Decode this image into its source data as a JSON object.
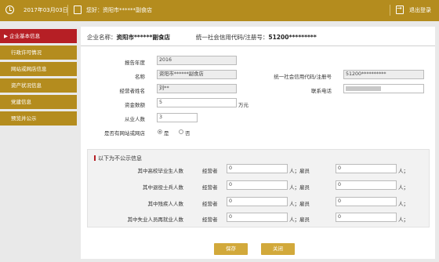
{
  "header": {
    "date": "2017年03月03日",
    "greeting": "您好：资阳市******副食店",
    "logout": "退出登录"
  },
  "sidebar": {
    "items": [
      {
        "label": "▶ 企业基本信息",
        "active": true
      },
      {
        "label": "行政许可情况"
      },
      {
        "label": "网站或网店信息"
      },
      {
        "label": "资产状况信息"
      },
      {
        "label": "党建信息"
      },
      {
        "label": "预览并公示"
      }
    ]
  },
  "company": {
    "name_label": "企业名称：",
    "name": "资阳市******副食店",
    "code_label": "统一社会信用代码/注册号：",
    "code": "51200*********"
  },
  "form": {
    "year_label": "报告年度",
    "year": "2016",
    "name_label": "名称",
    "name": "资阳市******副食店",
    "credit_label": "统一社会信用代码/注册号",
    "credit": "51200**********",
    "operator_label": "经营者姓名",
    "operator": "刘**",
    "phone_label": "联系电话",
    "capital_label": "资金数额",
    "capital": "5",
    "capital_unit": "万元",
    "staff_label": "从业人数",
    "staff": "3",
    "website_label": "是否有网站或网店",
    "website_yes": "是",
    "website_no": "否"
  },
  "private_section": {
    "title": "以下为不公示信息",
    "rows": [
      {
        "label": "其中高校毕业生人数",
        "op_label": "经营者",
        "op": "0",
        "sep": "人；雇员",
        "emp": "0",
        "end": "人；"
      },
      {
        "label": "其中退役士兵人数",
        "op_label": "经营者",
        "op": "0",
        "sep": "人；雇员",
        "emp": "0",
        "end": "人；"
      },
      {
        "label": "其中残疾人人数",
        "op_label": "经营者",
        "op": "0",
        "sep": "人；雇员",
        "emp": "0",
        "end": "人；"
      },
      {
        "label": "其中失业人员再就业人数",
        "op_label": "经营者",
        "op": "0",
        "sep": "人；雇员",
        "emp": "0",
        "end": "人；"
      }
    ]
  },
  "buttons": {
    "save": "保存",
    "close": "关闭"
  },
  "colors": {
    "gold": "#b48c1e",
    "active_red": "#b61f25",
    "button": "#d2a93b"
  }
}
